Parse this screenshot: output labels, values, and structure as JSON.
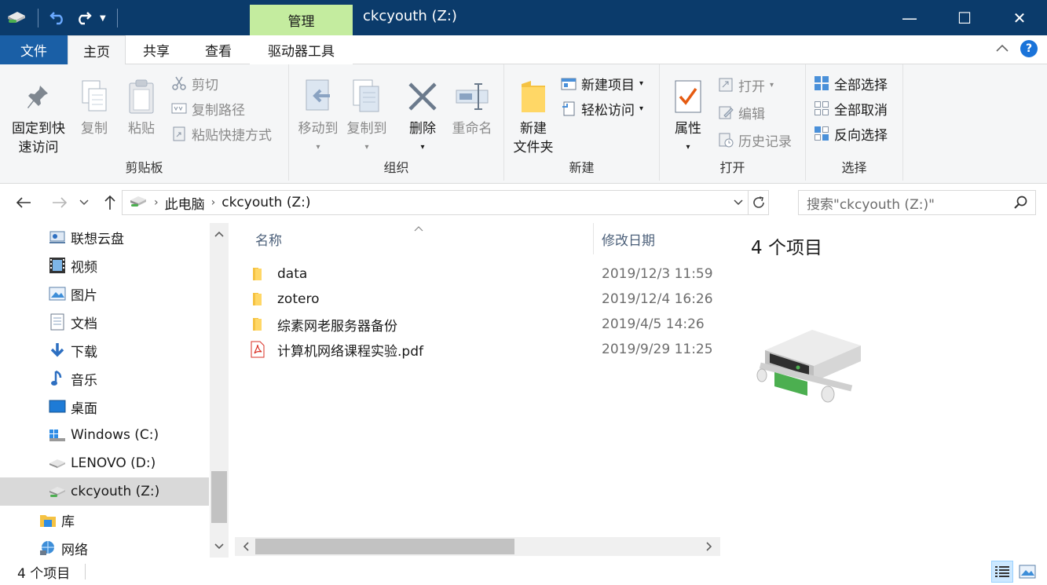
{
  "titlebar": {
    "manage_tab": "管理",
    "title": "ckcyouth (Z:)",
    "minimize_glyph": "—",
    "maximize_glyph": "☐",
    "close_glyph": "✕"
  },
  "tabs": {
    "file": "文件",
    "home": "主页",
    "share": "共享",
    "view": "查看",
    "drive_tools": "驱动器工具"
  },
  "ribbon": {
    "clipboard": {
      "label": "剪贴板",
      "pin_line1": "固定到快",
      "pin_line2": "速访问",
      "copy": "复制",
      "paste": "粘贴",
      "cut": "剪切",
      "copy_path": "复制路径",
      "paste_shortcut": "粘贴快捷方式"
    },
    "organize": {
      "label": "组织",
      "move_to": "移动到",
      "copy_to": "复制到",
      "delete": "删除",
      "rename": "重命名"
    },
    "new": {
      "label": "新建",
      "new_folder_line1": "新建",
      "new_folder_line2": "文件夹",
      "new_item": "新建项目",
      "easy_access": "轻松访问"
    },
    "open": {
      "label": "打开",
      "properties": "属性",
      "open": "打开",
      "edit": "编辑",
      "history": "历史记录"
    },
    "select": {
      "label": "选择",
      "select_all": "全部选择",
      "select_none": "全部取消",
      "invert": "反向选择"
    }
  },
  "address": {
    "crumbs": [
      "此电脑",
      "ckcyouth (Z:)"
    ],
    "search_placeholder": "搜索\"ckcyouth (Z:)\""
  },
  "navpane": {
    "items": [
      {
        "label": "联想云盘",
        "icon": "cloud-drive-icon"
      },
      {
        "label": "视频",
        "icon": "video-icon"
      },
      {
        "label": "图片",
        "icon": "pictures-icon"
      },
      {
        "label": "文档",
        "icon": "documents-icon"
      },
      {
        "label": "下载",
        "icon": "download-icon"
      },
      {
        "label": "音乐",
        "icon": "music-icon"
      },
      {
        "label": "桌面",
        "icon": "desktop-icon"
      },
      {
        "label": "Windows (C:)",
        "icon": "windows-drive-icon"
      },
      {
        "label": "LENOVO (D:)",
        "icon": "drive-icon"
      },
      {
        "label": "ckcyouth (Z:)",
        "icon": "network-drive-icon"
      },
      {
        "label": "库",
        "icon": "library-icon"
      },
      {
        "label": "网络",
        "icon": "network-icon"
      }
    ]
  },
  "filelist": {
    "col_name": "名称",
    "col_date": "修改日期",
    "rows": [
      {
        "name": "data",
        "date": "2019/12/3 11:59",
        "type": "folder"
      },
      {
        "name": "zotero",
        "date": "2019/12/4 16:26",
        "type": "folder"
      },
      {
        "name": "综素网老服务器备份",
        "date": "2019/4/5 14:26",
        "type": "folder"
      },
      {
        "name": "计算机网络课程实验.pdf",
        "date": "2019/9/29 11:25",
        "type": "pdf"
      }
    ]
  },
  "details": {
    "title": "4 个项目"
  },
  "status": {
    "count": "4 个项目"
  },
  "colors": {
    "titlebar": "#0b3b6b",
    "file_tab": "#1a5fa6",
    "manage_tab": "#c4ec9f",
    "folder": "#f5c242",
    "pdf_red": "#d93025"
  }
}
